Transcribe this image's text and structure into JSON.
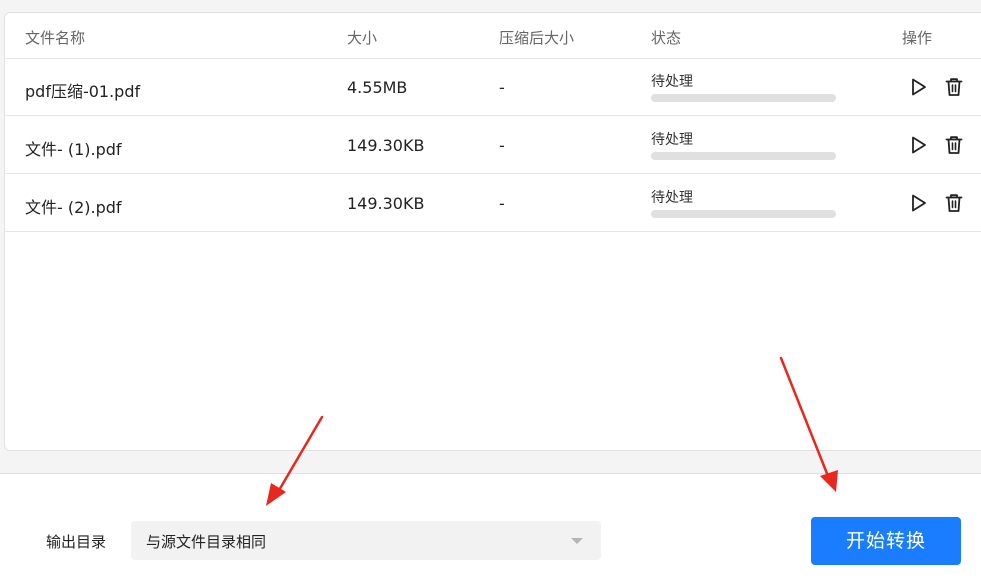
{
  "table": {
    "headers": {
      "name": "文件名称",
      "size": "大小",
      "compressed_size": "压缩后大小",
      "status": "状态",
      "actions": "操作"
    },
    "rows": [
      {
        "name": "pdf压缩-01.pdf",
        "size": "4.55MB",
        "compressed_size": "-",
        "status": "待处理",
        "progress": 0
      },
      {
        "name": "文件- (1).pdf",
        "size": "149.30KB",
        "compressed_size": "-",
        "status": "待处理",
        "progress": 0
      },
      {
        "name": "文件- (2).pdf",
        "size": "149.30KB",
        "compressed_size": "-",
        "status": "待处理",
        "progress": 0
      }
    ]
  },
  "output": {
    "label": "输出目录",
    "selected": "与源文件目录相同"
  },
  "start_button_label": "开始转换",
  "icons": {
    "play": "play-icon",
    "delete": "trash-icon",
    "dropdown": "caret-down-icon",
    "annotation": "red-arrow"
  },
  "colors": {
    "accent": "#1a7dff",
    "progress_track": "#e0e0e0",
    "annotation": "#e8281e"
  }
}
